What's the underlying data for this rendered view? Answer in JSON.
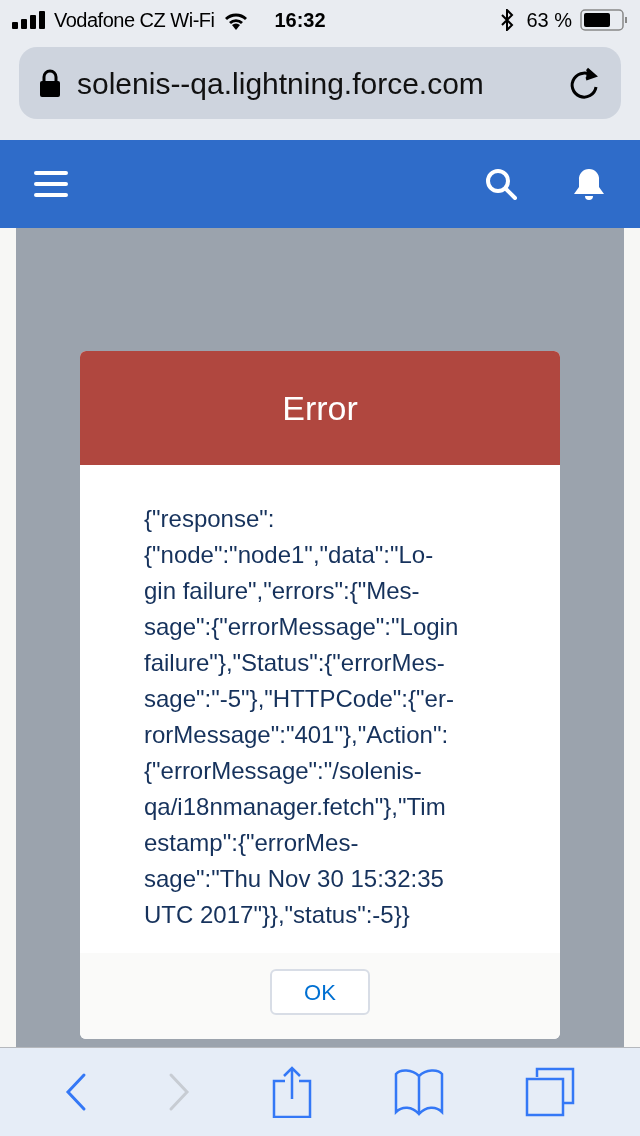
{
  "status_bar": {
    "carrier": "Vodafone CZ Wi-Fi",
    "time": "16:32",
    "battery": "63 %"
  },
  "address_bar": {
    "url": "solenis--qa.lightning.force.com"
  },
  "modal": {
    "title": "Error",
    "message_lines": [
      "{\"response\":",
      "{\"node\":\"node1\",\"data\":\"Lo-",
      "gin failure\",\"errors\":{\"Mes-",
      "sage\":{\"errorMessage\":\"Login",
      "failure\"},\"Status\":{\"errorMes-",
      "sage\":\"-5\"},\"HTTPCode\":{\"er-",
      "rorMessage\":\"401\"},\"Action\":",
      "{\"errorMessage\":\"/solenis-",
      "qa/i18nmanager.fetch\"},\"Tim",
      "estamp\":{\"errorMes-",
      "sage\":\"Thu Nov 30 15:32:35",
      "UTC 2017\"}},\"status\":-5}}"
    ],
    "button": "OK"
  },
  "toolbar": {
    "back_disabled": false,
    "forward_disabled": true
  }
}
